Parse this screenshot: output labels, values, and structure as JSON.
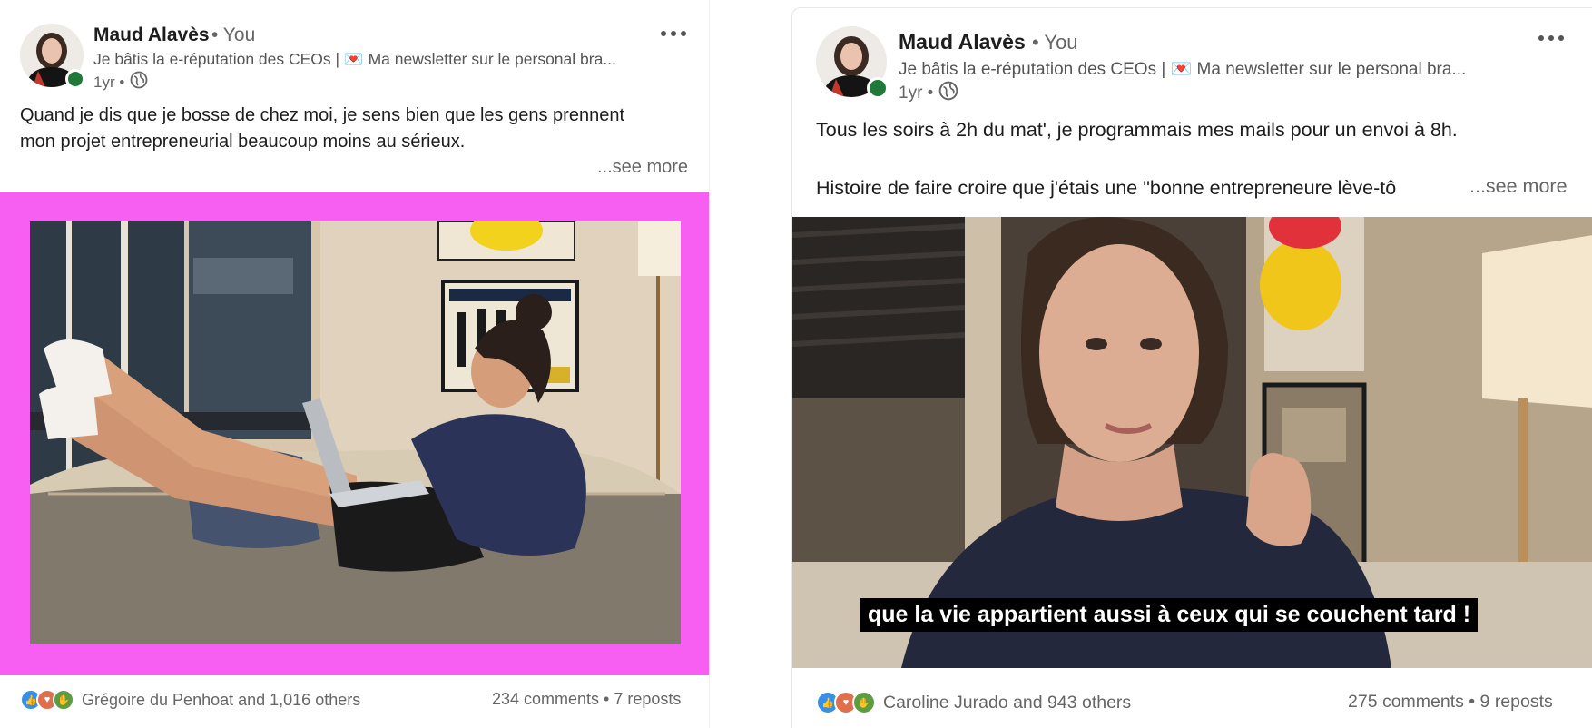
{
  "colors": {
    "left_frame_pink": "#f75ff2",
    "online_green": "#1f7a3a",
    "like_blue": "#378fe9",
    "love_orange": "#df704d",
    "support_green": "#5f9b41"
  },
  "posts": [
    {
      "author": {
        "name": "Maud Alavès",
        "you_label": "• You",
        "headline": "Je bâtis la e-réputation des CEOs | 💌 Ma newsletter sur le personal bra...",
        "time": "1yr •",
        "visibility_icon": "globe-icon"
      },
      "text_lines": [
        "Quand je dis que je bosse de chez moi, je sens bien que les gens prennent",
        "mon projet entrepreneurial beaucoup moins au sérieux."
      ],
      "see_more": "...see more",
      "media": {
        "type": "image",
        "description_icon": "photo-woman-on-couch"
      },
      "reactions": {
        "icons": [
          "like-icon",
          "love-icon",
          "support-icon"
        ],
        "text": "Grégoire du Penhoat and 1,016 others"
      },
      "counts": "234 comments • 7 reposts"
    },
    {
      "author": {
        "name": "Maud Alavès",
        "you_label": "• You",
        "headline": "Je bâtis la e-réputation des CEOs | 💌 Ma newsletter sur le personal bra...",
        "time": "1yr •",
        "visibility_icon": "globe-icon"
      },
      "text_lines": [
        "Tous les soirs à 2h du mat', je programmais mes mails pour un envoi à 8h.",
        "",
        "Histoire de faire croire que j'étais une \"bonne entrepreneure lève-tô"
      ],
      "see_more": "...see more",
      "media": {
        "type": "video",
        "caption": "que la vie appartient aussi à ceux qui se couchent tard !"
      },
      "reactions": {
        "icons": [
          "like-icon",
          "love-icon",
          "support-icon"
        ],
        "text": "Caroline Jurado and 943 others"
      },
      "counts": "275 comments • 9 reposts"
    }
  ]
}
